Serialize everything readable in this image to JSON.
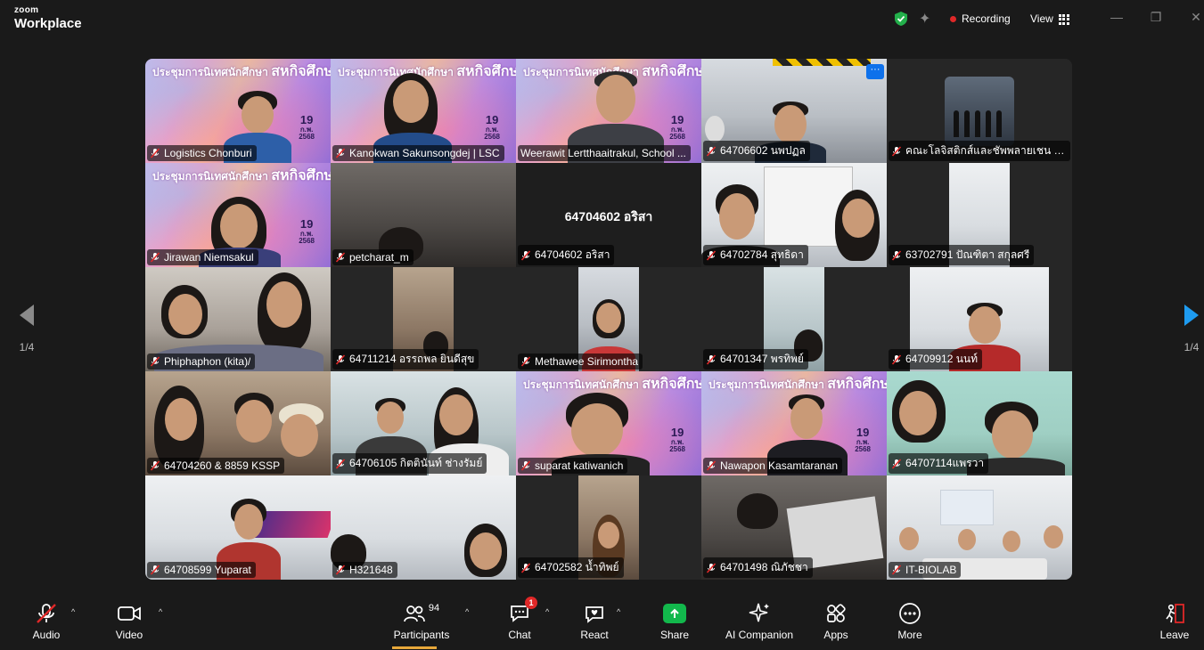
{
  "app": {
    "brand_top": "zoom",
    "brand_bottom": "Workplace"
  },
  "titlebar": {
    "recording_label": "Recording",
    "view_label": "View"
  },
  "pager": {
    "left_label": "1/4",
    "right_label": "1/4"
  },
  "slide": {
    "title_small": "ประชุมการนิเทศนักศึกษา",
    "title_big": "สหกิจศึกษา",
    "date_day": "19",
    "date_month": "ก.พ.",
    "date_year": "2568"
  },
  "tiles": [
    {
      "name": "Logistics Chonburi"
    },
    {
      "name": "Kanokwan Sakunsongdej | LSC"
    },
    {
      "name": "Weerawit Lertthaaitrakul, School ..."
    },
    {
      "name": "64706602 นพปฏล"
    },
    {
      "name": "คณะโลจิสติกส์และชัพพลายเชน มห..."
    },
    {
      "name": "Jirawan Niemsakul"
    },
    {
      "name": "petcharat_m"
    },
    {
      "name": "64704602 อริสา",
      "center": "64704602 อริสา"
    },
    {
      "name": "64702784 สุทธิดา"
    },
    {
      "name": "63702791 ปัณฑิตา สกุลศรี"
    },
    {
      "name": "Phiphaphon (kita)/"
    },
    {
      "name": "64711214 อรรถพล ยินดีสุข"
    },
    {
      "name": "Methawee Sirimontha"
    },
    {
      "name": "64701347 พรทิพย์"
    },
    {
      "name": "64709912 นนท์"
    },
    {
      "name": "64704260 & 8859 KSSP"
    },
    {
      "name": "64706105 กิตตินันท์ ช่างรัมย์"
    },
    {
      "name": "suparat katiwanich"
    },
    {
      "name": "Nawapon Kasamtaranan"
    },
    {
      "name": "64707114แพรวา"
    },
    {
      "name": "64708599 Yuparat"
    },
    {
      "name": "H321648"
    },
    {
      "name": "64702582 น้ำทิพย์"
    },
    {
      "name": "64701498 ณิภัชชา"
    },
    {
      "name": "IT-BIOLAB"
    }
  ],
  "toolbar": {
    "audio": "Audio",
    "video": "Video",
    "participants": "Participants",
    "participants_count": "94",
    "chat": "Chat",
    "chat_badge": "1",
    "react": "React",
    "share": "Share",
    "ai_companion": "AI Companion",
    "apps": "Apps",
    "more": "More",
    "leave": "Leave"
  },
  "colors": {
    "accent_green": "#34c759",
    "record_red": "#e02828",
    "share_green": "#12b84c",
    "more_blue": "#0e71eb"
  }
}
